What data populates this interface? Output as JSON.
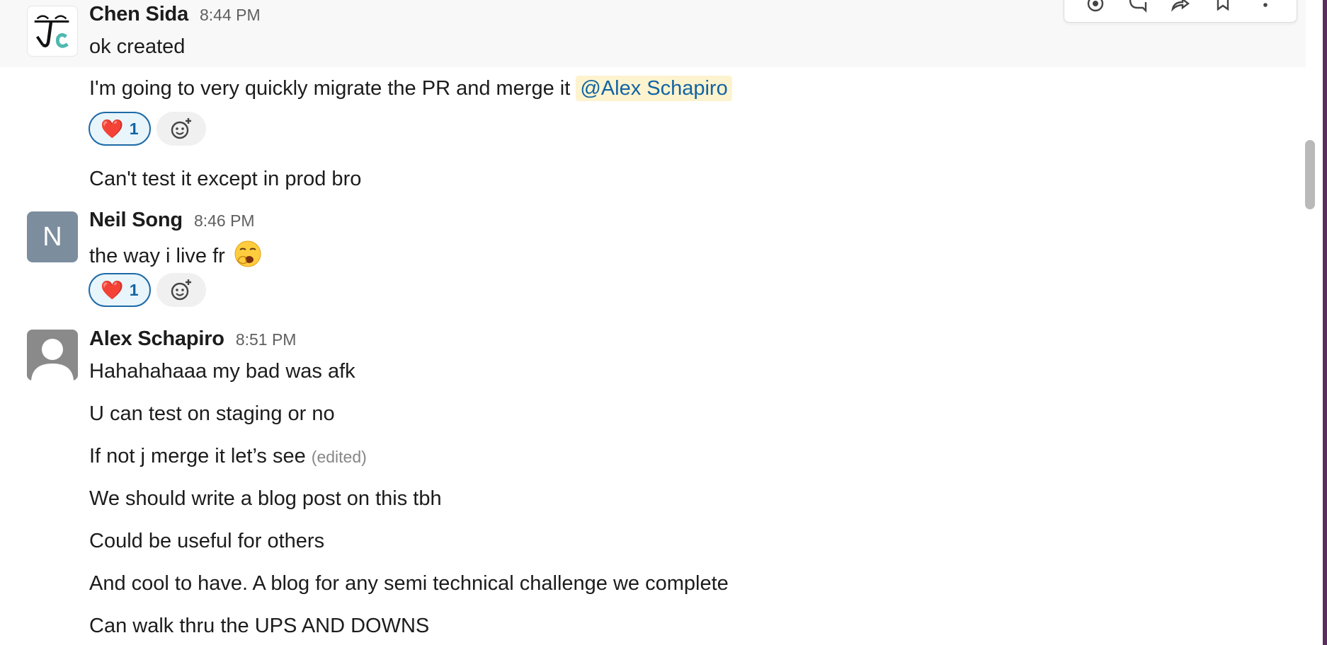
{
  "toolbar": {
    "icons": [
      "complete-icon",
      "reply-in-thread-icon",
      "forward-icon",
      "bookmark-icon",
      "more-icon"
    ]
  },
  "messages": {
    "chen": {
      "name": "Chen Sida",
      "time": "8:44 PM",
      "lines": [
        "ok created",
        "I'm going to very quickly migrate the PR and merge it",
        "Can't test it except in prod bro"
      ],
      "mention": "@Alex Schapiro",
      "reaction": {
        "emoji": "❤️",
        "count": "1"
      }
    },
    "neil": {
      "name": "Neil Song",
      "initial": "N",
      "time": "8:46 PM",
      "text": "the way i live fr",
      "reaction": {
        "emoji": "❤️",
        "count": "1"
      }
    },
    "alex": {
      "name": "Alex Schapiro",
      "time": "8:51 PM",
      "lines": [
        "Hahahahaaa my bad was afk",
        "U can test on staging or no",
        "If not j merge it let’s see",
        "We should write a blog post on this tbh",
        "Could be useful for others",
        "And cool to have. A blog for any semi technical challenge we complete",
        "Can walk thru the UPS AND DOWNS"
      ],
      "edited": "(edited)"
    }
  },
  "colors": {
    "accent_blue": "#1264a3",
    "mention_bg": "#fdf3cf",
    "workspace_purple": "#5b2c5f"
  }
}
